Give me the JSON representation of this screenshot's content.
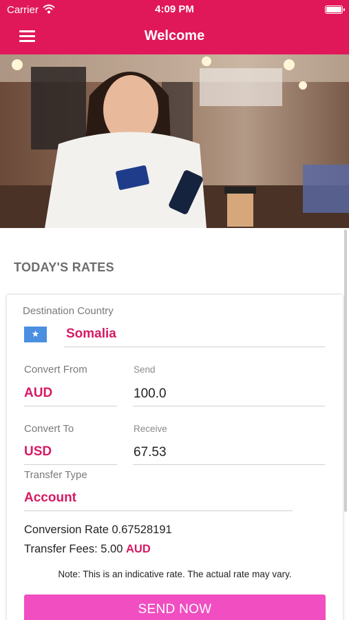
{
  "status_bar": {
    "carrier": "Carrier",
    "time": "4:09 PM"
  },
  "nav": {
    "title": "Welcome"
  },
  "rates": {
    "section_title": "TODAY'S RATES",
    "destination_label": "Destination Country",
    "destination_value": "Somalia",
    "convert_from_label": "Convert From",
    "convert_from_value": "AUD",
    "send_label": "Send",
    "send_value": "100.0",
    "convert_to_label": "Convert To",
    "convert_to_value": "USD",
    "receive_label": "Receive",
    "receive_value": "67.53",
    "transfer_type_label": "Transfer Type",
    "transfer_type_value": "Account",
    "conversion_rate_label": "Conversion Rate",
    "conversion_rate_value": "0.67528191",
    "transfer_fees_label": "Transfer Fees:",
    "transfer_fees_value": "5.00",
    "transfer_fees_currency": "AUD",
    "note": "Note: This is an indicative rate. The actual rate may vary.",
    "send_button": "SEND NOW"
  },
  "colors": {
    "brand": "#e0185a",
    "accent_text": "#d61a63",
    "button": "#f04ec1",
    "flag_blue": "#4a8fe0"
  },
  "icons": {
    "menu": "hamburger-menu-icon",
    "wifi": "wifi-icon",
    "battery": "battery-icon",
    "flag": "somalia-flag-icon"
  }
}
